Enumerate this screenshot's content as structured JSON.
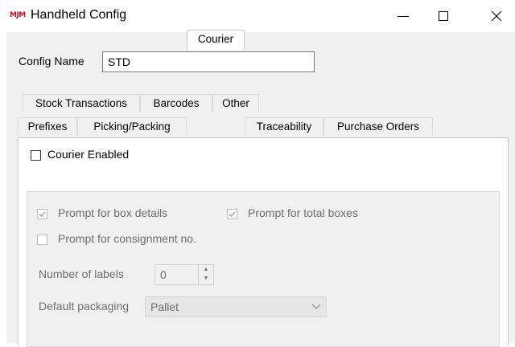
{
  "window": {
    "logo_text": "MJM",
    "title": "Handheld Config",
    "minimize_glyph": "—",
    "maximize_glyph": "☐",
    "close_glyph": "X"
  },
  "config": {
    "label": "Config Name",
    "value": "STD"
  },
  "tabs": {
    "row1": [
      "Stock Transactions",
      "Barcodes",
      "Other"
    ],
    "row2": [
      "Prefixes",
      "Picking/Packing",
      "Courier",
      "Traceability",
      "Purchase Orders"
    ],
    "active": "Courier"
  },
  "courier": {
    "enabled_label": "Courier Enabled",
    "enabled_checked": false,
    "prompt_box_label": "Prompt for box details",
    "prompt_box_checked": true,
    "prompt_total_label": "Prompt for total boxes",
    "prompt_total_checked": true,
    "prompt_consignment_label": "Prompt for consignment no.",
    "prompt_consignment_checked": false,
    "labels_label": "Number of labels",
    "labels_value": "0",
    "packaging_label": "Default packaging",
    "packaging_value": "Pallet"
  },
  "colors": {
    "logo": "#c8102e",
    "panel_bg": "#f0f0f0",
    "disabled_text": "#6d6d6d"
  }
}
